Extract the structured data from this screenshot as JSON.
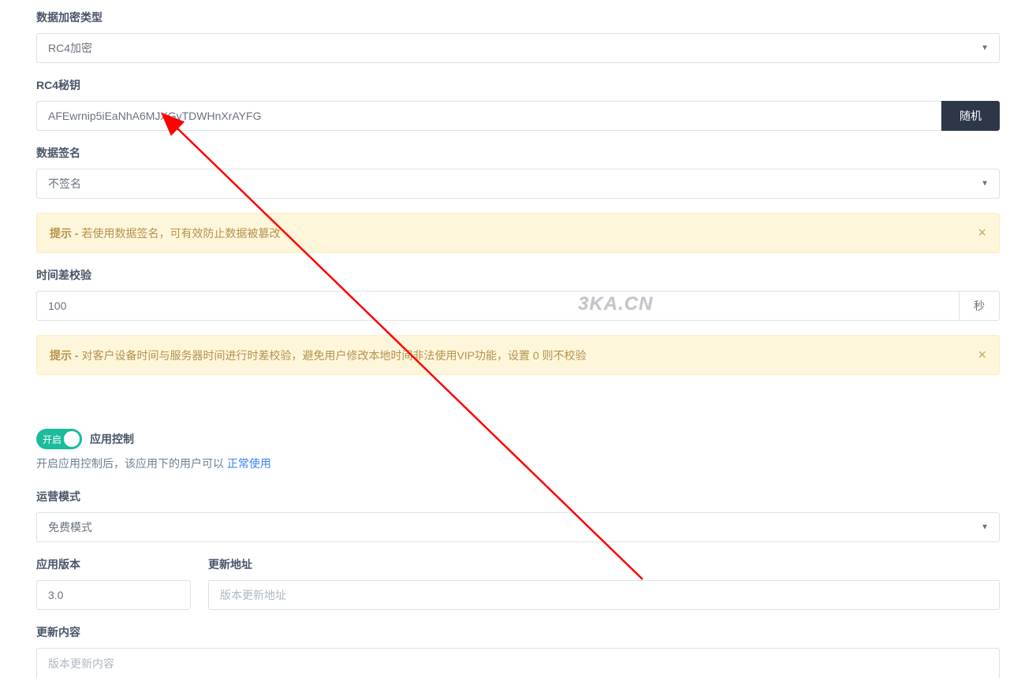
{
  "encryption": {
    "label": "数据加密类型",
    "value": "RC4加密"
  },
  "rc4key": {
    "label": "RC4秘钥",
    "value": "AFEwrnip5iEaNhA6MJXGyTDWHnXrAYFG",
    "button": "随机"
  },
  "signature": {
    "label": "数据签名",
    "value": "不签名",
    "tip_prefix": "提示 - ",
    "tip": "若使用数据签名，可有效防止数据被篡改"
  },
  "timecheck": {
    "label": "时间差校验",
    "value": "100",
    "suffix": "秒",
    "tip_prefix": "提示 - ",
    "tip": "对客户设备时间与服务器时间进行时差校验，避免用户修改本地时间非法使用VIP功能，设置 0 则不校验"
  },
  "appcontrol": {
    "toggle_on": "开启",
    "title": "应用控制",
    "desc_prefix": "开启应用控制后，该应用下的用户可以 ",
    "desc_highlight": "正常使用"
  },
  "mode": {
    "label": "运营模式",
    "value": "免费模式"
  },
  "version": {
    "label": "应用版本",
    "value": "3.0"
  },
  "updateurl": {
    "label": "更新地址",
    "placeholder": "版本更新地址"
  },
  "updatecontent": {
    "label": "更新内容",
    "placeholder": "版本更新内容"
  },
  "watermark": "3KA.CN"
}
